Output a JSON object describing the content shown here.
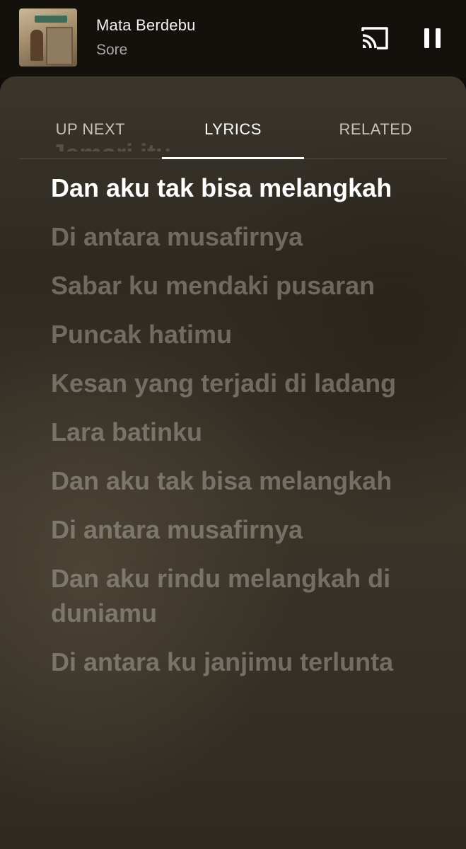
{
  "mini_player": {
    "title": "Mata Berdebu",
    "artist": "Sore",
    "cast_icon": "cast-icon",
    "pause_icon": "pause-icon"
  },
  "tabs": [
    {
      "label": "UP NEXT",
      "active": false
    },
    {
      "label": "LYRICS",
      "active": true
    },
    {
      "label": "RELATED",
      "active": false
    }
  ],
  "lyrics": {
    "previous_line": "Jemari itu",
    "current_line": "Dan aku tak bisa melangkah",
    "upcoming": [
      "Di antara musafirnya",
      "Sabar ku mendaki pusaran",
      "Puncak hatimu",
      "Kesan yang terjadi di ladang",
      "Lara batinku",
      "Dan aku tak bisa melangkah",
      "Di antara musafirnya",
      "Dan aku rindu melangkah di duniamu",
      "Di antara ku janjimu terlunta"
    ]
  },
  "colors": {
    "background": "#0f0d0a",
    "sheet": "#3b352b",
    "active_text": "#ffffff",
    "inactive_lyric": "#c8c4bc"
  }
}
